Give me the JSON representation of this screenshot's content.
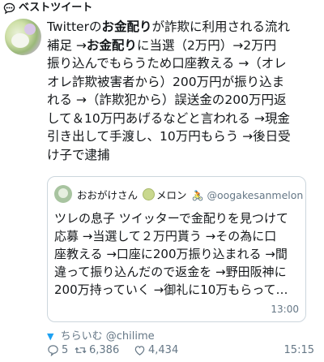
{
  "header": {
    "title": "ベストツイート",
    "icon": "speech-bubble-icon"
  },
  "tweet": {
    "lines": [
      [
        {
          "t": "Twitterの"
        },
        {
          "t": "お金配り",
          "b": true
        },
        {
          "t": "が詐欺に利用される流れ"
        }
      ],
      [
        {
          "t": "補足 →"
        },
        {
          "t": "お金配り",
          "b": true
        },
        {
          "t": "に当選（2万円）→2万円"
        }
      ],
      [
        {
          "t": "振り込んでもらうため口座教える →（オレ"
        }
      ],
      [
        {
          "t": "オレ詐欺被害者から）200万円が振り込ま"
        }
      ],
      [
        {
          "t": "れる →（詐欺犯から）誤送金の200万円返"
        }
      ],
      [
        {
          "t": "して＆10万円あげるなどと言われる →現金"
        }
      ],
      [
        {
          "t": "引き出して手渡し、10万円もらう →後日受"
        }
      ],
      [
        {
          "t": "け子で逮捕"
        }
      ]
    ]
  },
  "quote": {
    "name": "おおがけさん",
    "emoji_text": "メロン",
    "handle": "@oogakesanmelon",
    "lines": [
      "ツレの息子 ツイッターで金配りを見つけて",
      "応募 →当選して２万円貰う →その為に口",
      "座教える →口座に200万振り込まれる →間",
      "違って振り込んだので返金を →野田阪神に",
      "200万持っていく →御礼に10万もらって…"
    ],
    "time": "13:00"
  },
  "retweet": {
    "label": "ちらいむ",
    "handle": "@chilime"
  },
  "stats": {
    "replies": "5",
    "retweets": "6,386",
    "likes": "4,434",
    "time": "15:15"
  },
  "colors": {
    "accent": "#1da1f2",
    "muted": "#657786",
    "border": "#ccd6dd"
  }
}
